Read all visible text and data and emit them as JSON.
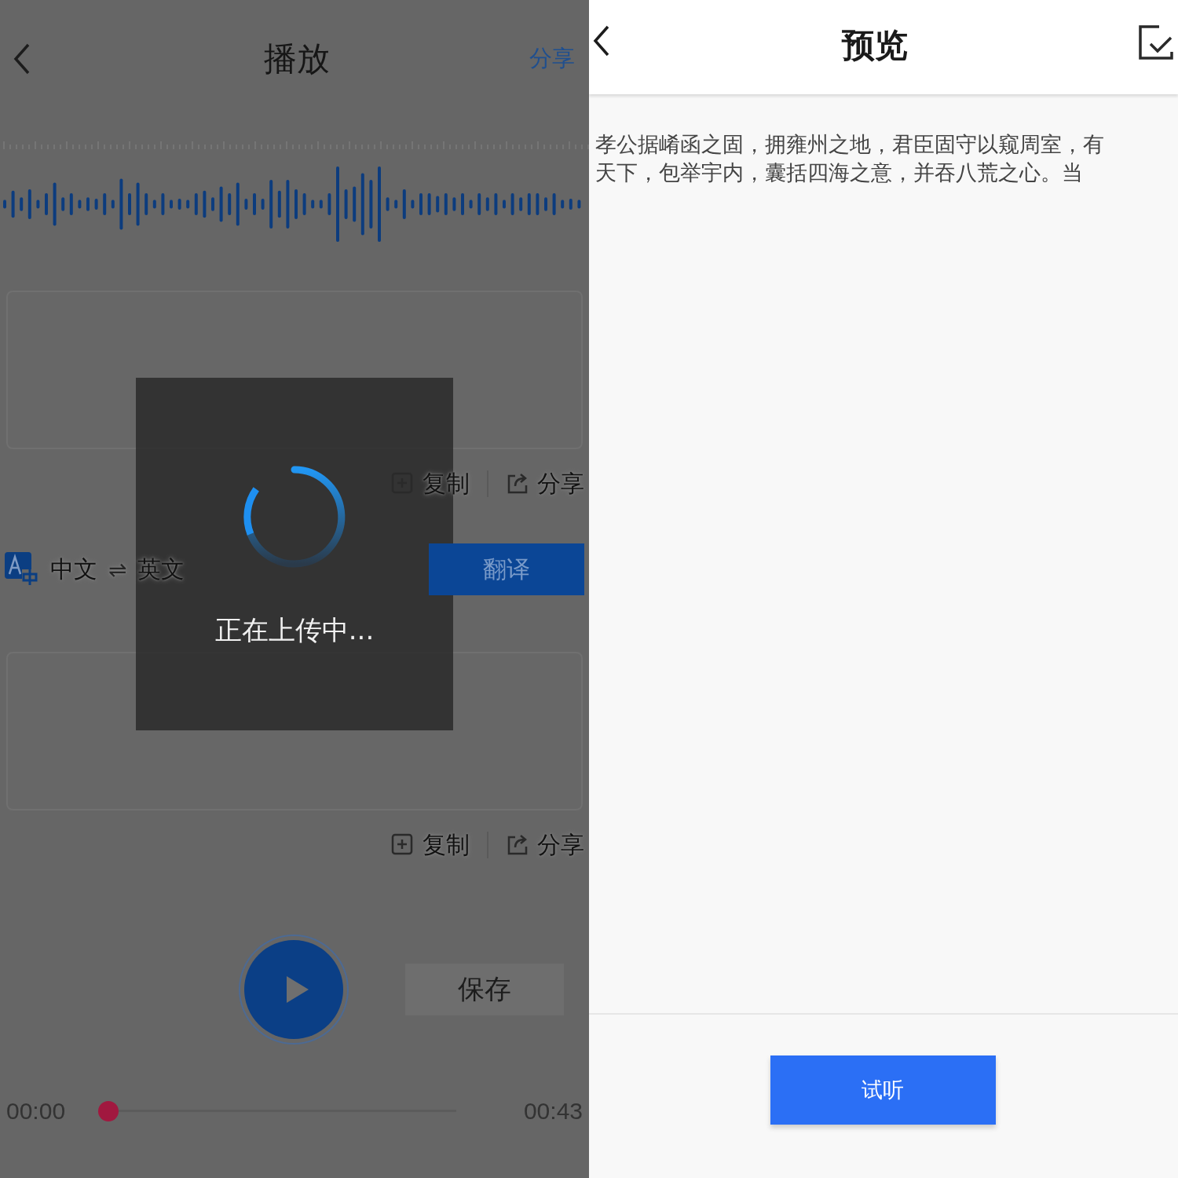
{
  "play_screen": {
    "title": "播放",
    "share_link": "分享",
    "transcript_box": {
      "actions": [
        {
          "kind": "copy",
          "label": "复制"
        },
        {
          "kind": "share",
          "label": "分享"
        }
      ]
    },
    "language": {
      "source": "中文",
      "swap": "⇌",
      "target": "英文"
    },
    "translate_button": "翻译",
    "translation_box": {
      "actions": [
        {
          "kind": "copy",
          "label": "复制"
        },
        {
          "kind": "share",
          "label": "分享"
        }
      ]
    },
    "save_button": "保存",
    "playback": {
      "elapsed": "00:00",
      "level": 0,
      "total": "00:43"
    },
    "loading": {
      "message": "正在上传中..."
    }
  },
  "preview_screen": {
    "title": "预览",
    "text_lines": [
      "孝公据崤函之固，拥雍州之地，君臣固守以窥周室，有",
      "天下，包举宇内，囊括四海之意，并吞八荒之心。当"
    ],
    "listen_button": "试听"
  }
}
